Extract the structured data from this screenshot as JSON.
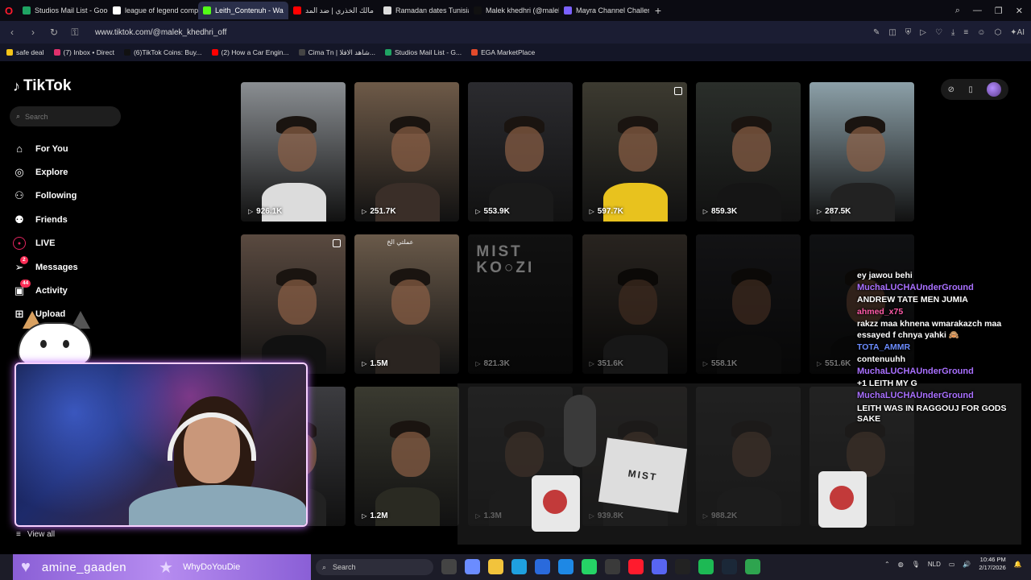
{
  "browser": {
    "tabs": [
      {
        "label": "Studios Mail List - Google",
        "color": "#1fa463",
        "active": false
      },
      {
        "label": "league of legend compet",
        "color": "#ffffff",
        "active": false
      },
      {
        "label": "Leith_Contenuh - Wa",
        "color": "#53fc18",
        "active": true
      },
      {
        "label": "مالك الخذري | ضد المد",
        "color": "#ff0000",
        "active": false
      },
      {
        "label": "Ramadan dates Tunisia",
        "color": "#dddddd",
        "active": false
      },
      {
        "label": "Malek khedhri (@malek_k",
        "color": "#111111",
        "active": false
      },
      {
        "label": "Mayra Channel Challenge",
        "color": "#7b61ff",
        "active": false
      }
    ],
    "url": "www.tiktok.com/@malek_khedhri_off",
    "bookmarks": [
      {
        "label": "safe deal",
        "color": "#f5c518"
      },
      {
        "label": "(7) Inbox • Direct",
        "color": "#e1306c"
      },
      {
        "label": "(6)TikTok Coins: Buy...",
        "color": "#111111"
      },
      {
        "label": "(2) How a Car Engin...",
        "color": "#ff0000"
      },
      {
        "label": "Cima Tn | شاهد الافلا...",
        "color": "#444444"
      },
      {
        "label": "Studios Mail List - G...",
        "color": "#1fa463"
      },
      {
        "label": "EGA MarketPlace",
        "color": "#e24a2b"
      }
    ]
  },
  "tiktok": {
    "logo": "TikTok",
    "search_placeholder": "Search",
    "nav": [
      {
        "label": "For You",
        "icon": "home-icon",
        "glyph": "⌂"
      },
      {
        "label": "Explore",
        "icon": "compass-icon",
        "glyph": "◎"
      },
      {
        "label": "Following",
        "icon": "following-icon",
        "glyph": "⚇"
      },
      {
        "label": "Friends",
        "icon": "friends-icon",
        "glyph": "⚉"
      },
      {
        "label": "LIVE",
        "icon": "live-icon",
        "glyph": "LIVE"
      },
      {
        "label": "Messages",
        "icon": "messages-icon",
        "glyph": "➢",
        "badge": "2"
      },
      {
        "label": "Activity",
        "icon": "activity-icon",
        "glyph": "▣",
        "badge": "44"
      },
      {
        "label": "Upload",
        "icon": "upload-icon",
        "glyph": "⊞"
      }
    ],
    "view_all": "View all",
    "videos": [
      {
        "views": "926.1K",
        "bg": "#8a8e92",
        "shirt": "#dcdcdc"
      },
      {
        "views": "251.7K",
        "bg": "#6e5a48",
        "shirt": "#3a2e28"
      },
      {
        "views": "553.9K",
        "bg": "#2b2b2f",
        "shirt": "#1a1a1a"
      },
      {
        "views": "597.7K",
        "bg": "#3c3a30",
        "shirt": "#e8c21e"
      },
      {
        "views": "859.3K",
        "bg": "#2a2e2a",
        "shirt": "#151515"
      },
      {
        "views": "287.5K",
        "bg": "#8ca0a8",
        "shirt": "#222222"
      },
      {
        "views": "",
        "bg": "#5a4a40",
        "shirt": "#111111"
      },
      {
        "views": "1.5M",
        "bg": "#6a5a4a",
        "shirt": "#2a2420"
      },
      {
        "views": "821.3K",
        "bg": "#262626",
        "shirt": "#1b1b1b"
      },
      {
        "views": "351.6K",
        "bg": "#5a5046",
        "shirt": "#333333"
      },
      {
        "views": "558.1K",
        "bg": "#2a2a2e",
        "shirt": "#1a1a1a"
      },
      {
        "views": "551.6K",
        "bg": "#24262a",
        "shirt": "#111111"
      },
      {
        "views": "",
        "bg": "#3c3c40",
        "shirt": "#222222"
      },
      {
        "views": "1.2M",
        "bg": "#3a3a30",
        "shirt": "#2a2a22"
      },
      {
        "views": "1.3M",
        "bg": "#2e2e2e",
        "shirt": "#1c1c1c"
      },
      {
        "views": "939.8K",
        "bg": "#34302c",
        "shirt": "#222222"
      },
      {
        "views": "988.2K",
        "bg": "#282828",
        "shirt": "#1a1a1a"
      },
      {
        "views": "",
        "bg": "#303030",
        "shirt": "#1a1a1a"
      }
    ],
    "mist_title": "MIST KO○ZI",
    "arabic_caption": "عملتي الخ"
  },
  "stream": {
    "chat": [
      {
        "type": "msg",
        "text": "ey jawou behi"
      },
      {
        "type": "user",
        "text": "MuchaLUCHAUnderGround"
      },
      {
        "type": "msg",
        "text": "ANDREW TATE MEN JUMIA"
      },
      {
        "type": "user2",
        "text": "ahmed_x75"
      },
      {
        "type": "msg",
        "text": "rakzz maa khnena wmarakazch maa essayed f chnya yahki 🙈"
      },
      {
        "type": "user3",
        "text": "TOTA_AMMR"
      },
      {
        "type": "msg",
        "text": "contenuuhh"
      },
      {
        "type": "user",
        "text": "MuchaLUCHAUnderGround"
      },
      {
        "type": "msg",
        "text": "+1 LEITH MY G"
      },
      {
        "type": "user",
        "text": "MuchaLUCHAUnderGround"
      },
      {
        "type": "msg",
        "text": "LEITH WAS IN RAGGOUJ FOR GODS SAKE"
      }
    ],
    "alert_name_1": "amine_gaaden",
    "alert_name_2": "WhyDoYouDie"
  },
  "taskbar": {
    "search_placeholder": "Search",
    "language": "NLD",
    "time": "10:46 PM",
    "date": "2/17/2026",
    "icons": [
      {
        "name": "task-view-icon",
        "color": "#444"
      },
      {
        "name": "copilot-icon",
        "color": "#6b8cff"
      },
      {
        "name": "file-explorer-icon",
        "color": "#f2c33c"
      },
      {
        "name": "edge-icon",
        "color": "#1fa0e0"
      },
      {
        "name": "store-icon",
        "color": "#2a6adc"
      },
      {
        "name": "vscode-icon",
        "color": "#1e88e5"
      },
      {
        "name": "whatsapp-icon",
        "color": "#25d366"
      },
      {
        "name": "notepad-icon",
        "color": "#3a3a3a"
      },
      {
        "name": "opera-icon",
        "color": "#ff1b2d"
      },
      {
        "name": "discord-icon",
        "color": "#5865f2"
      },
      {
        "name": "obs-icon",
        "color": "#222"
      },
      {
        "name": "spotify-icon",
        "color": "#1db954"
      },
      {
        "name": "steam-icon",
        "color": "#1b2838"
      },
      {
        "name": "app-icon",
        "color": "#2ea44f"
      }
    ]
  }
}
